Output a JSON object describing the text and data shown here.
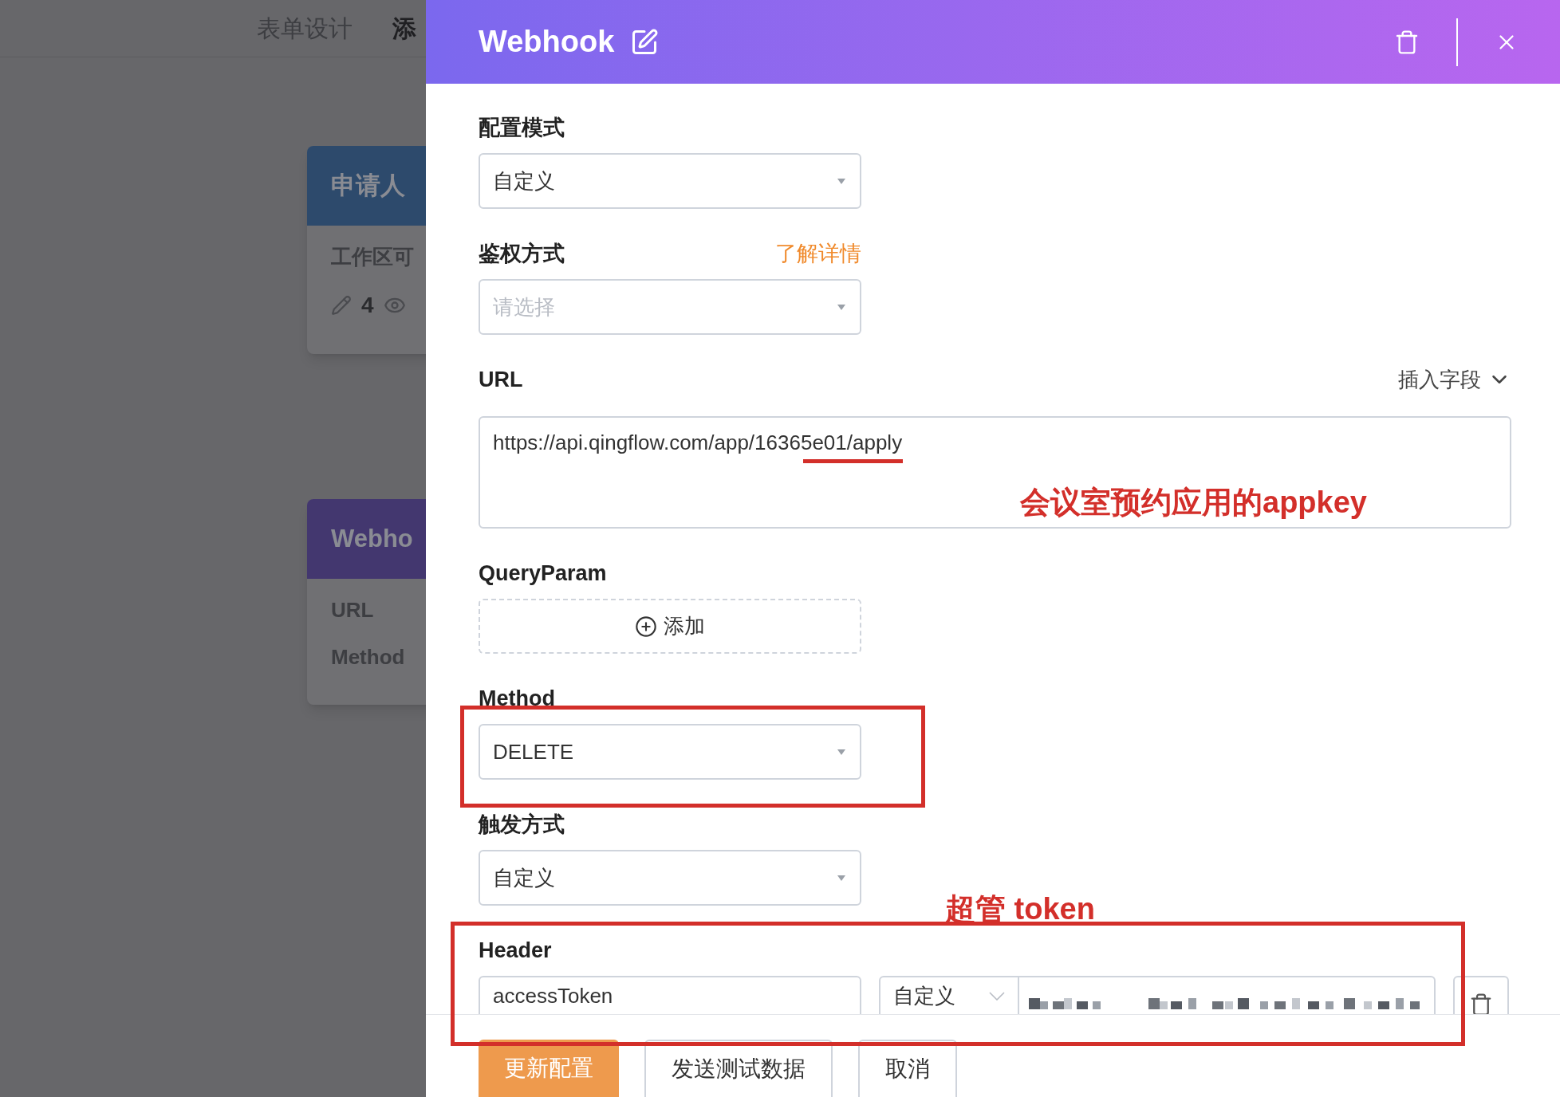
{
  "background_page": {
    "nav_tabs": [
      {
        "label": "表单设计",
        "selected": false
      },
      {
        "label": "添",
        "selected": true
      }
    ],
    "nodes": [
      {
        "kind": "applicant",
        "title": "申请人",
        "lines": [
          "工作区可"
        ],
        "counts": [
          "4"
        ]
      },
      {
        "kind": "webhook",
        "title": "Webho",
        "lines": [
          "URL",
          "Method"
        ]
      }
    ]
  },
  "panel": {
    "title": "Webhook",
    "fields": [
      {
        "kind": "select",
        "label": "配置模式",
        "value": "自定义"
      },
      {
        "kind": "select",
        "label": "鉴权方式",
        "link": "了解详情",
        "placeholder": "请选择"
      },
      {
        "kind": "textarea",
        "label": "URL",
        "action": "插入字段",
        "value": "https://api.qingflow.com/app/16365e01/apply"
      },
      {
        "kind": "add",
        "label": "QueryParam",
        "button": "添加"
      },
      {
        "kind": "select",
        "label": "Method",
        "value": "DELETE"
      },
      {
        "kind": "select",
        "label": "触发方式",
        "value": "自定义"
      },
      {
        "kind": "header",
        "label": "Header",
        "key": "accessToken",
        "source": "自定义"
      }
    ],
    "annotations": [
      {
        "kind": "appkey",
        "text": "会议室预约应用的appkey"
      },
      {
        "kind": "token",
        "text": "超管 token"
      }
    ],
    "footer": [
      {
        "label": "更新配置",
        "kind": "primary"
      },
      {
        "label": "发送测试数据",
        "kind": "default"
      },
      {
        "label": "取消",
        "kind": "default"
      }
    ]
  }
}
